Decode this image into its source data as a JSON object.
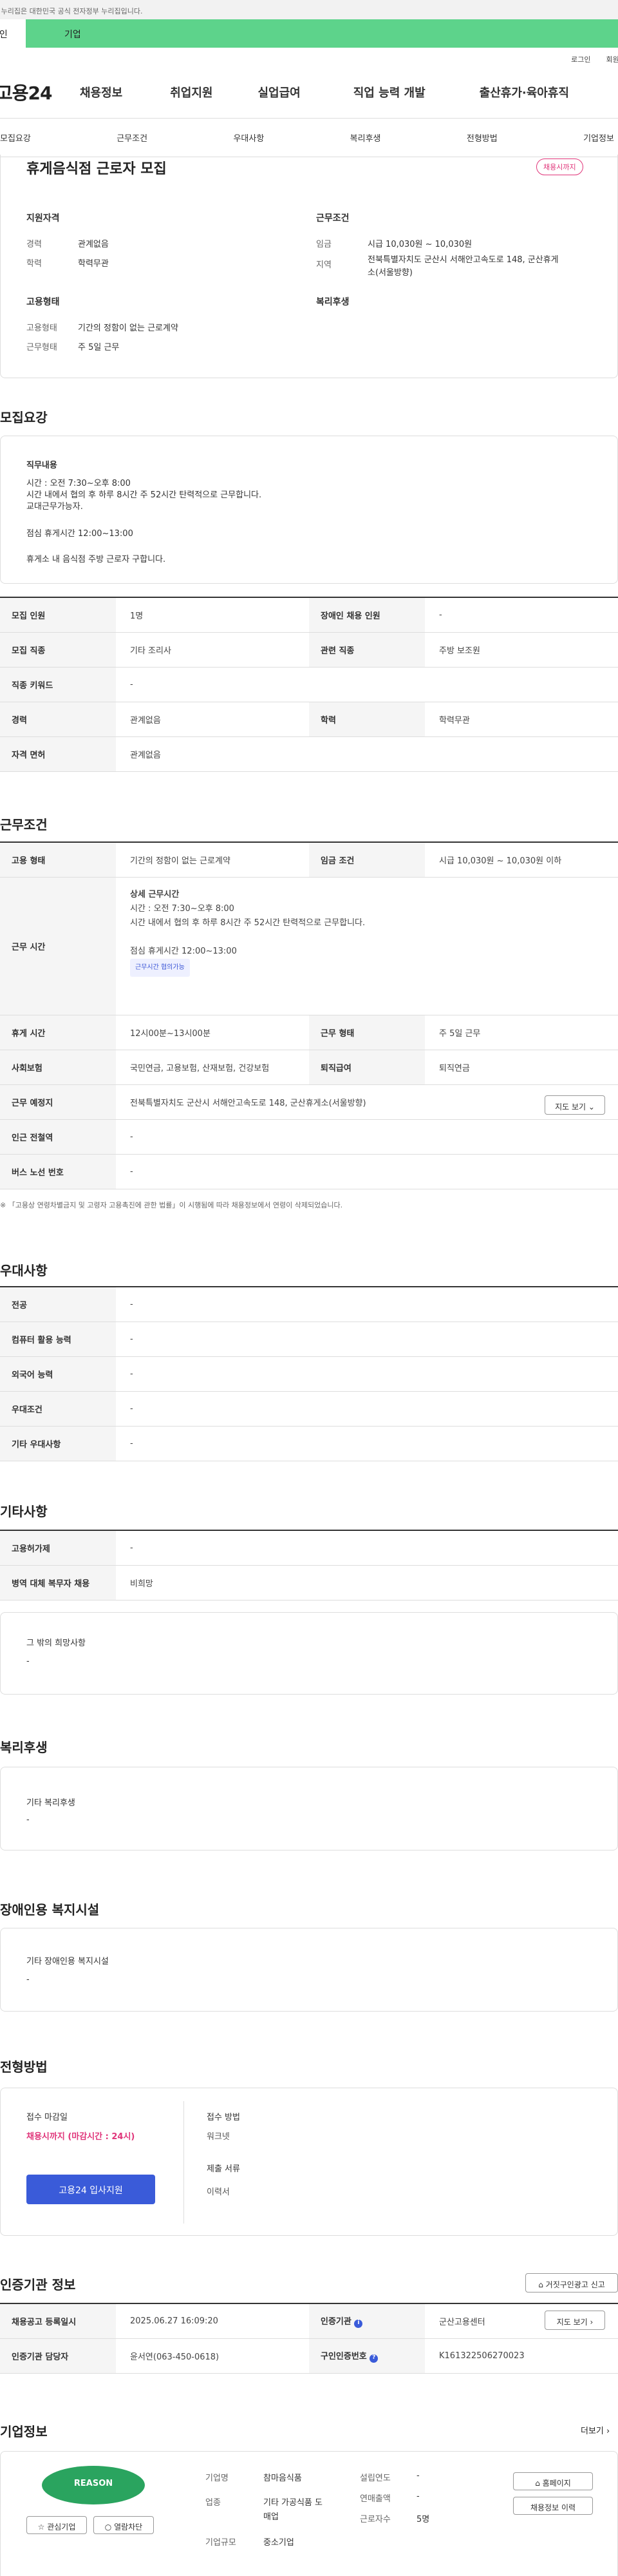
{
  "gov_banner": {
    "text": "이 누리집은 대한민국 공식 전자정부 누리집입니다."
  },
  "audience_tabs": [
    {
      "label": "개인"
    },
    {
      "label": "기업"
    }
  ],
  "util_links": [
    {
      "label": "로그인"
    },
    {
      "label": "회원가입"
    }
  ],
  "site": {
    "logo": "고용24"
  },
  "gnb": [
    {
      "label": "채용정보"
    },
    {
      "label": "취업지원"
    },
    {
      "label": "실업급여"
    },
    {
      "label": "직업 능력 개발"
    },
    {
      "label": "출산휴가·육아휴직"
    }
  ],
  "anchors": [
    {
      "label": "모집요강"
    },
    {
      "label": "근무조건"
    },
    {
      "label": "우대사항"
    },
    {
      "label": "복리후생"
    },
    {
      "label": "전형방법"
    },
    {
      "label": "기업정보"
    }
  ],
  "job": {
    "title": "휴게음식점 근로자 모집",
    "status_badge": "채용시까지"
  },
  "summary": {
    "qual_title": "지원자격",
    "career_label": "경력",
    "career_value": "관계없음",
    "edu_label": "학력",
    "edu_value": "학력무관",
    "cond_title": "근무조건",
    "wage_label": "임금",
    "wage_value": "시급 10,030원 ~ 10,030원",
    "loc_label": "지역",
    "loc_value1": "전북특별자치도 군산시 서해안고속도로 148, 군산휴게",
    "loc_value2": "소(서울방향)",
    "emp_title": "고용형태",
    "emp_label": "고용형태",
    "emp_value": "기간의 정함이 없는 근로계약",
    "week_label": "근무형태",
    "week_value": "주 5일 근무",
    "welfare_title": "복리후생"
  },
  "recruit": {
    "section_title": "모집요강",
    "duty_title": "직무내용",
    "duty_lines": [
      "시간 : 오전 7:30~오후 8:00",
      "시간 내에서 협의 후 하루 8시간 주 52시간 탄력적으로 근무합니다.",
      "교대근무가능자.",
      "",
      "점심 휴게시간 12:00~13:00",
      "",
      "휴게소 내 음식점 주방 근로자 구합니다."
    ],
    "table": [
      {
        "k1": "모집 인원",
        "v1": "1명",
        "k2": "장애인 채용 인원",
        "v2": "-"
      },
      {
        "k1": "모집 직종",
        "v1": "기타 조리사",
        "k2": "관련 직종",
        "v2": "주방 보조원"
      },
      {
        "k1": "직종 키워드",
        "v1": "-"
      },
      {
        "k1": "경력",
        "v1": "관계없음",
        "k2": "학력",
        "v2": "학력무관"
      },
      {
        "k1": "자격 면허",
        "v1": "관계없음"
      }
    ]
  },
  "work": {
    "section_title": "근무조건",
    "emp_k": "고용 형태",
    "emp_v": "기간의 정함이 없는 근로계약",
    "wage_k": "임금 조건",
    "wage_v": "시급 10,030원 ~ 10,030원 이하",
    "time_k": "근무 시간",
    "time_title": "상세 근무시간",
    "time_lines": [
      "시간 : 오전 7:30~오후 8:00",
      "시간 내에서 협의 후 하루 8시간 주 52시간 탄력적으로 근무합니다.",
      "",
      "점심 휴게시간 12:00~13:00"
    ],
    "time_chip": "근무시간 협의가능",
    "break_k": "휴게 시간",
    "break_v": "12시00분~13시00분",
    "type_k": "근무 형태",
    "type_v": "주 5일 근무",
    "ins_k": "사회보험",
    "ins_v": "국민연금, 고용보험, 산재보험, 건강보험",
    "ret_k": "퇴직급여",
    "ret_v": "퇴직연금",
    "place_k": "근무 예정지",
    "place_v": "전북특별자치도 군산시 서해안고속도로 148, 군산휴게소(서울방향)",
    "map_btn": "지도 보기",
    "subway_k": "인근 전철역",
    "subway_v": "-",
    "bus_k": "버스 노선 번호",
    "bus_v": "-",
    "note": "※ 「고용상 연령차별금지 및 고령자 고용촉진에 관한 법률」이 시행됨에 따라 채용정보에서 연령이 삭제되었습니다."
  },
  "pref": {
    "section_title": "우대사항",
    "rows": [
      {
        "k": "전공",
        "v": "-"
      },
      {
        "k": "컴퓨터 활용 능력",
        "v": "-"
      },
      {
        "k": "외국어 능력",
        "v": "-"
      },
      {
        "k": "우대조건",
        "v": "-"
      },
      {
        "k": "기타 우대사항",
        "v": "-"
      }
    ]
  },
  "etc": {
    "section_title": "기타사항",
    "rows": [
      {
        "k": "고용허가제",
        "v": "-"
      },
      {
        "k": "병역 대체 복무자 채용",
        "v": "비희망"
      }
    ],
    "wish_title": "그 밖의 희망사항",
    "wish_value": "-"
  },
  "welfare": {
    "section_title": "복리후생",
    "title": "기타 복리후생",
    "value": "-"
  },
  "disabled": {
    "section_title": "장애인용 복지시설",
    "title": "기타 장애인용 복지시설",
    "value": "-"
  },
  "apply": {
    "section_title": "전형방법",
    "deadline_title": "접수 마감일",
    "deadline_value": "채용시까지 (마감시간 : 24시)",
    "apply_btn": "고용24 입사지원",
    "method_title": "접수 방법",
    "method_value": "워크넷",
    "docs_title": "제출 서류",
    "docs_value": "이력서"
  },
  "agency": {
    "section_title": "인증기관 정보",
    "report_btn": "거짓구인광고 신고",
    "reg_k": "채용공고 등록일시",
    "reg_v": "2025.06.27 16:09:20",
    "org_k": "인증기관",
    "org_v": "군산고용센터",
    "map_btn": "지도 보기",
    "mgr_k": "인증기관 담당자",
    "mgr_v": "윤서연(063-450-0618)",
    "no_k": "구인인증번호",
    "no_v": "K161322506270023"
  },
  "company": {
    "section_title": "기업정보",
    "more": "더보기",
    "logo_text": "REASON",
    "fav_btn": "관심기업",
    "block_btn": "열람차단",
    "name_k": "기업명",
    "name_v": "참마음식품",
    "ind_k": "업종",
    "ind_v1": "기타 가공식품 도",
    "ind_v2": "매업",
    "size_k": "기업규모",
    "size_v": "중소기업",
    "year_k": "설립연도",
    "year_v": "-",
    "sales_k": "연매출액",
    "sales_v": "-",
    "emp_k": "근로자수",
    "emp_v": "5명",
    "home_btn": "홈페이지",
    "history_btn": "채용정보 이력"
  }
}
